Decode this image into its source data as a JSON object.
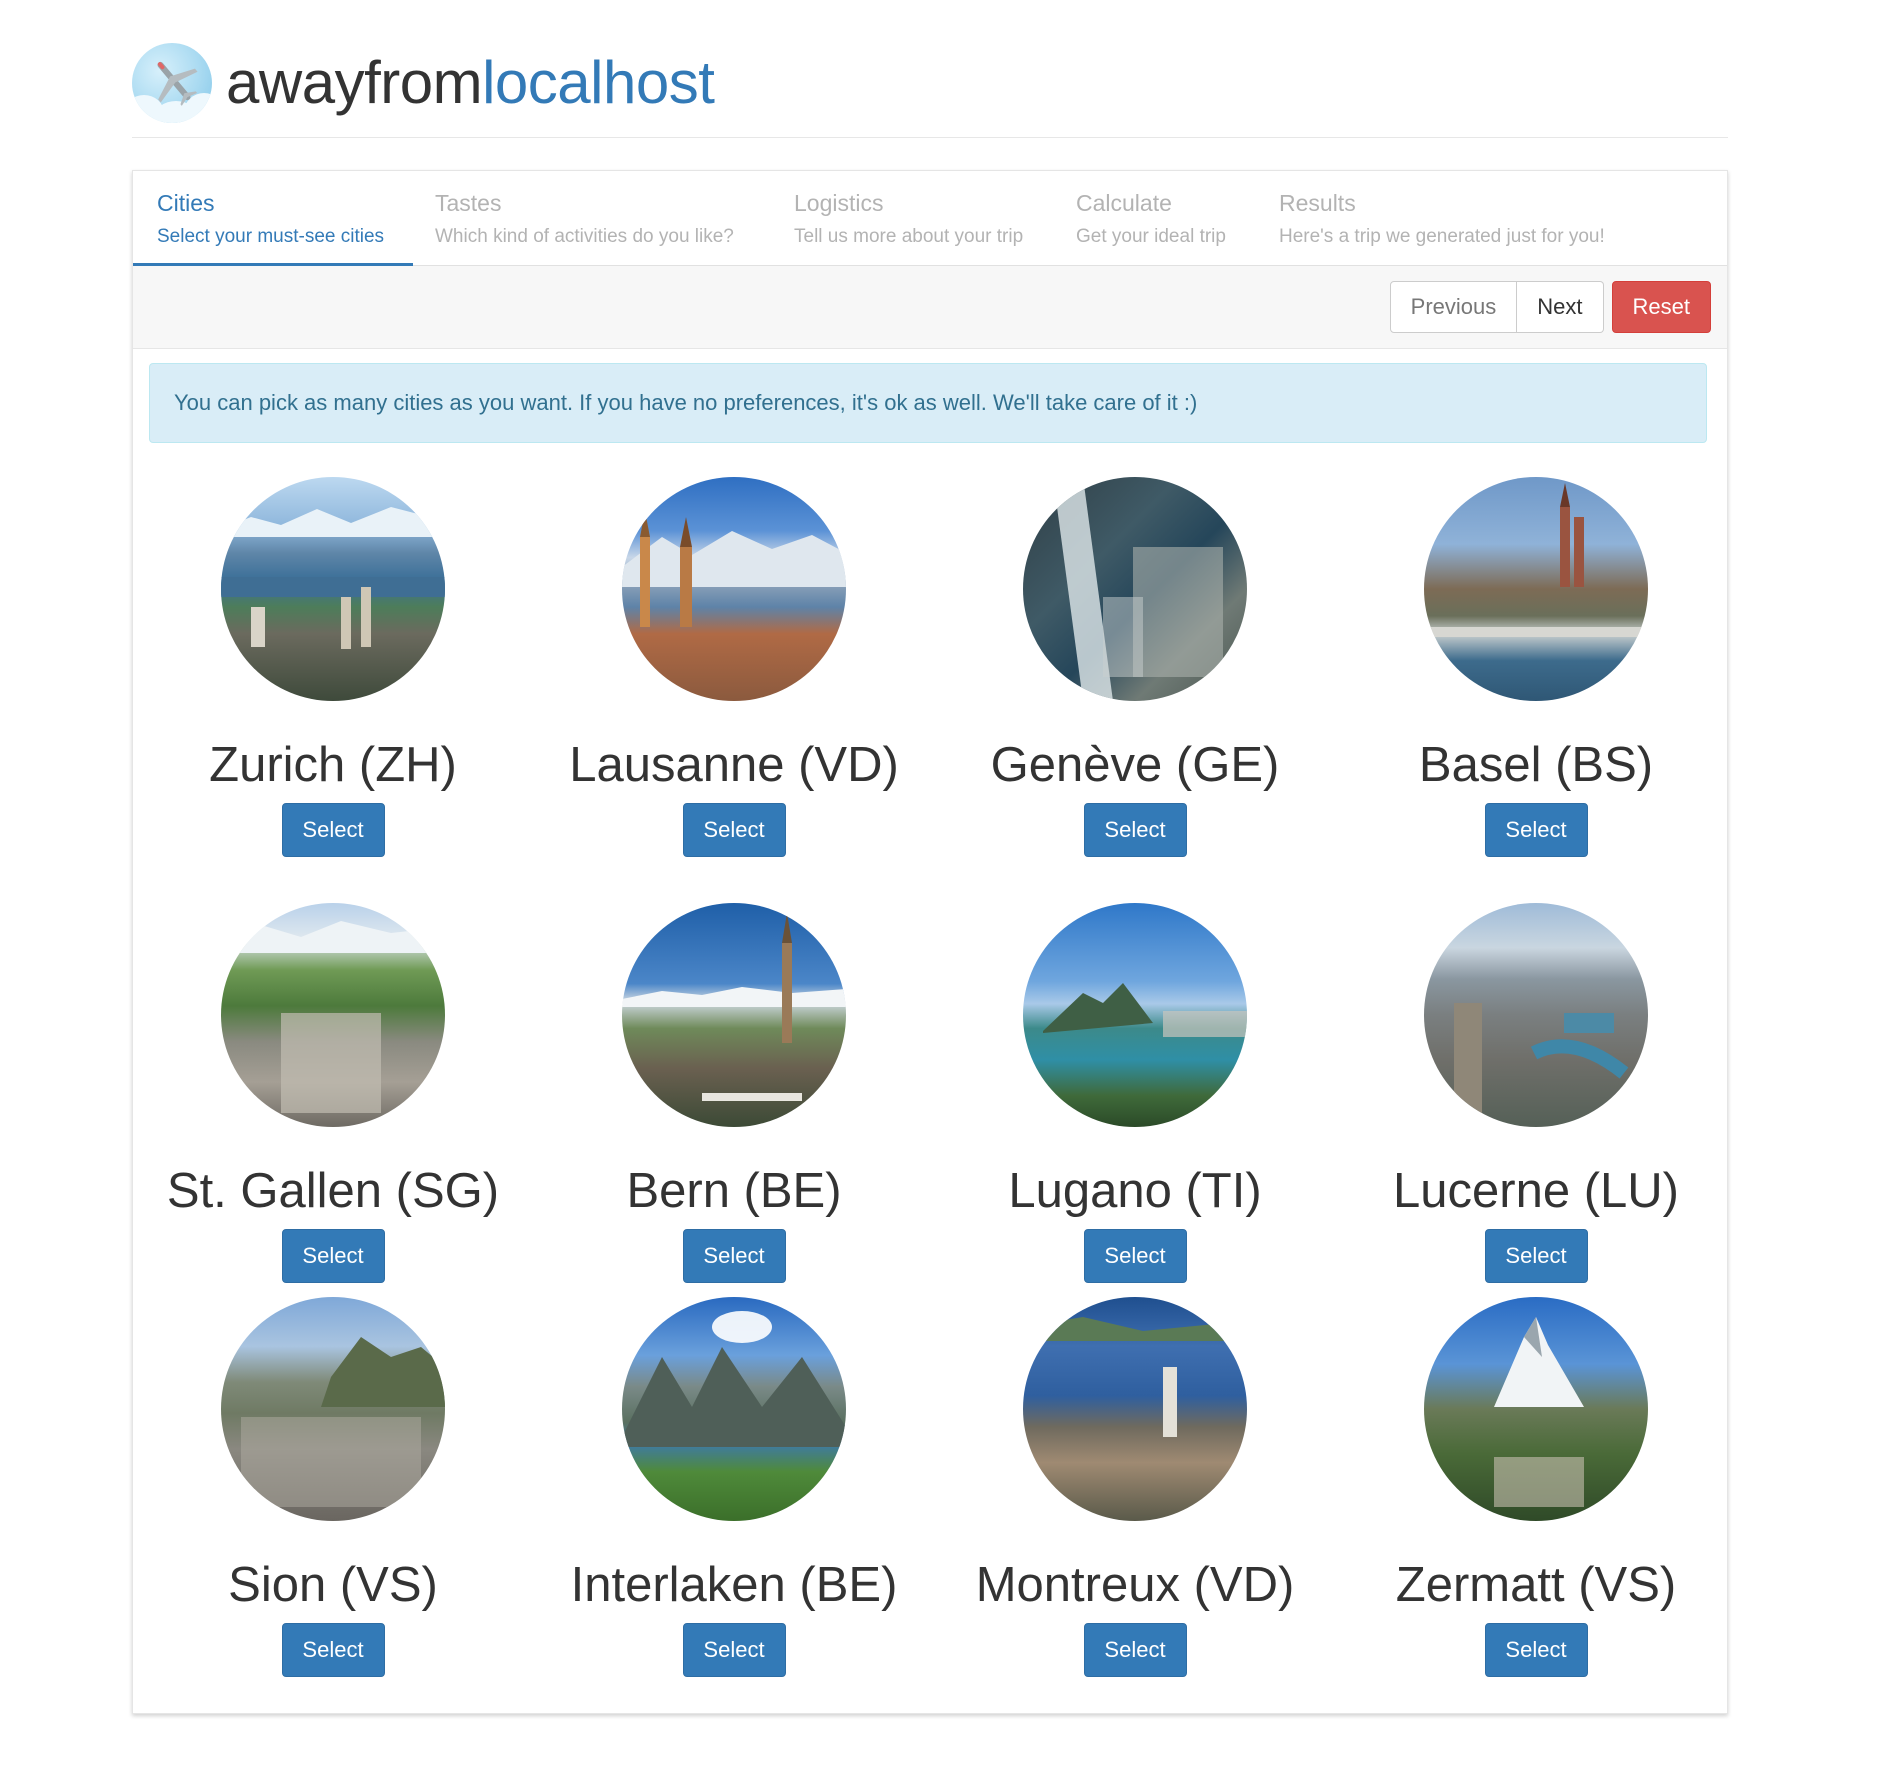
{
  "brand": {
    "name_part1": "awayfrom",
    "name_part2": "localhost",
    "logo_icon": "airplane-cloud-icon"
  },
  "steps": [
    {
      "title": "Cities",
      "subtitle": "Select your must-see cities",
      "active": true
    },
    {
      "title": "Tastes",
      "subtitle": "Which kind of activities do you like?",
      "active": false
    },
    {
      "title": "Logistics",
      "subtitle": "Tell us more about your trip",
      "active": false
    },
    {
      "title": "Calculate",
      "subtitle": "Get your ideal trip",
      "active": false
    },
    {
      "title": "Results",
      "subtitle": "Here's a trip we generated just for you!",
      "active": false
    }
  ],
  "toolbar": {
    "previous_label": "Previous",
    "next_label": "Next",
    "reset_label": "Reset"
  },
  "alert": {
    "message": "You can pick as many cities as you want. If you have no preferences, it's ok as well. We'll take care of it :)"
  },
  "cities": [
    {
      "name": "Zurich (ZH)",
      "button": "Select"
    },
    {
      "name": "Lausanne (VD)",
      "button": "Select"
    },
    {
      "name": "Genève (GE)",
      "button": "Select"
    },
    {
      "name": "Basel (BS)",
      "button": "Select"
    },
    {
      "name": "St. Gallen (SG)",
      "button": "Select"
    },
    {
      "name": "Bern (BE)",
      "button": "Select"
    },
    {
      "name": "Lugano (TI)",
      "button": "Select"
    },
    {
      "name": "Lucerne (LU)",
      "button": "Select"
    },
    {
      "name": "Sion (VS)",
      "button": "Select"
    },
    {
      "name": "Interlaken (BE)",
      "button": "Select"
    },
    {
      "name": "Montreux (VD)",
      "button": "Select"
    },
    {
      "name": "Zermatt (VS)",
      "button": "Select"
    }
  ],
  "colors": {
    "primary": "#337ab7",
    "danger": "#d9534f",
    "info_bg": "#d9edf7",
    "info_text": "#31708f"
  }
}
